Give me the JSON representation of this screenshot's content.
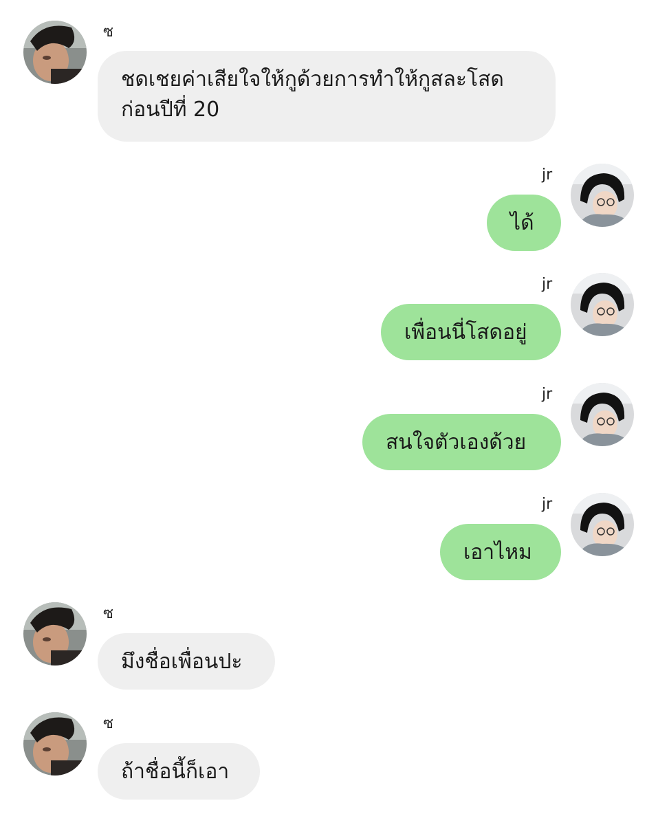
{
  "colors": {
    "incoming_bubble": "#efefef",
    "outgoing_bubble": "#9ee39a",
    "background": "#ffffff"
  },
  "messages": [
    {
      "sender": "ซ",
      "side": "left",
      "avatar": "avatar-photo-male-dark-hair",
      "text": "ชดเชยค่าเสียใจให้กูด้วยการทำให้กูสละโสด ก่อนปีที่ 20"
    },
    {
      "sender": "jr",
      "side": "right",
      "avatar": "avatar-photo-black-beanie",
      "text": "ได้"
    },
    {
      "sender": "jr",
      "side": "right",
      "avatar": "avatar-photo-black-beanie",
      "text": "เพื่อนนี่โสดอยู่"
    },
    {
      "sender": "jr",
      "side": "right",
      "avatar": "avatar-photo-black-beanie",
      "text": "สนใจตัวเองด้วย"
    },
    {
      "sender": "jr",
      "side": "right",
      "avatar": "avatar-photo-black-beanie",
      "text": "เอาไหม"
    },
    {
      "sender": "ซ",
      "side": "left",
      "avatar": "avatar-photo-male-dark-hair",
      "text": "มึงชื่อเพื่อนปะ"
    },
    {
      "sender": "ซ",
      "side": "left",
      "avatar": "avatar-photo-male-dark-hair",
      "text": "ถ้าชื่อนี้ก็เอา"
    }
  ]
}
